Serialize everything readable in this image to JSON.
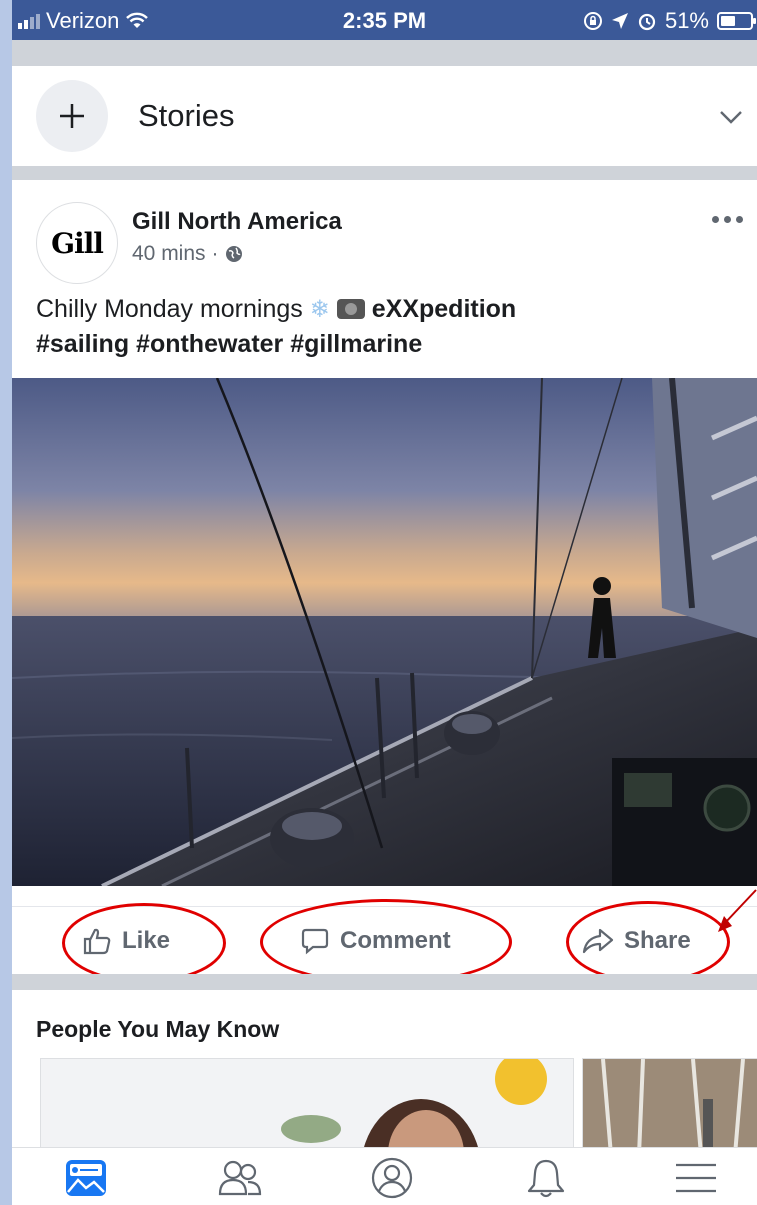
{
  "status_bar": {
    "carrier": "Verizon",
    "time": "2:35 PM",
    "battery": "51%",
    "battery_level": 0.51,
    "icons": [
      "signal-icon",
      "wifi-icon",
      "orientation-lock-icon",
      "location-icon",
      "alarm-icon",
      "battery-icon"
    ]
  },
  "stories": {
    "label": "Stories",
    "add_icon": "plus-icon",
    "expand_icon": "chevron-down-icon"
  },
  "post": {
    "author": "Gill North America",
    "avatar_text": "Gill",
    "time": "40 mins",
    "separator": "·",
    "privacy_icon": "globe-icon",
    "text_plain": "Chilly Monday mornings",
    "text_bold_inline": "eXXpedition",
    "hashtags": "#sailing #onthewater #gillmarine",
    "emoji": [
      "snowflake-icon",
      "camera-with-flash-icon"
    ],
    "photo": "sailboat-at-sunset-photo",
    "actions": {
      "like": "Like",
      "comment": "Comment",
      "share": "Share"
    }
  },
  "people_you_may_know": {
    "title": "People You May Know"
  },
  "tab_bar": {
    "items": [
      "news-feed-icon",
      "friends-icon",
      "profile-icon",
      "notifications-icon",
      "menu-icon"
    ]
  },
  "annotations": {
    "highlight_color": "#e00000",
    "circled": [
      "Like",
      "Comment",
      "Share"
    ],
    "arrow_target": "Share"
  },
  "colors": {
    "status_bar": "#3b5998",
    "page_background": "#b7c8e6",
    "divider": "#cfd3d9",
    "secondary_text": "#606770"
  }
}
